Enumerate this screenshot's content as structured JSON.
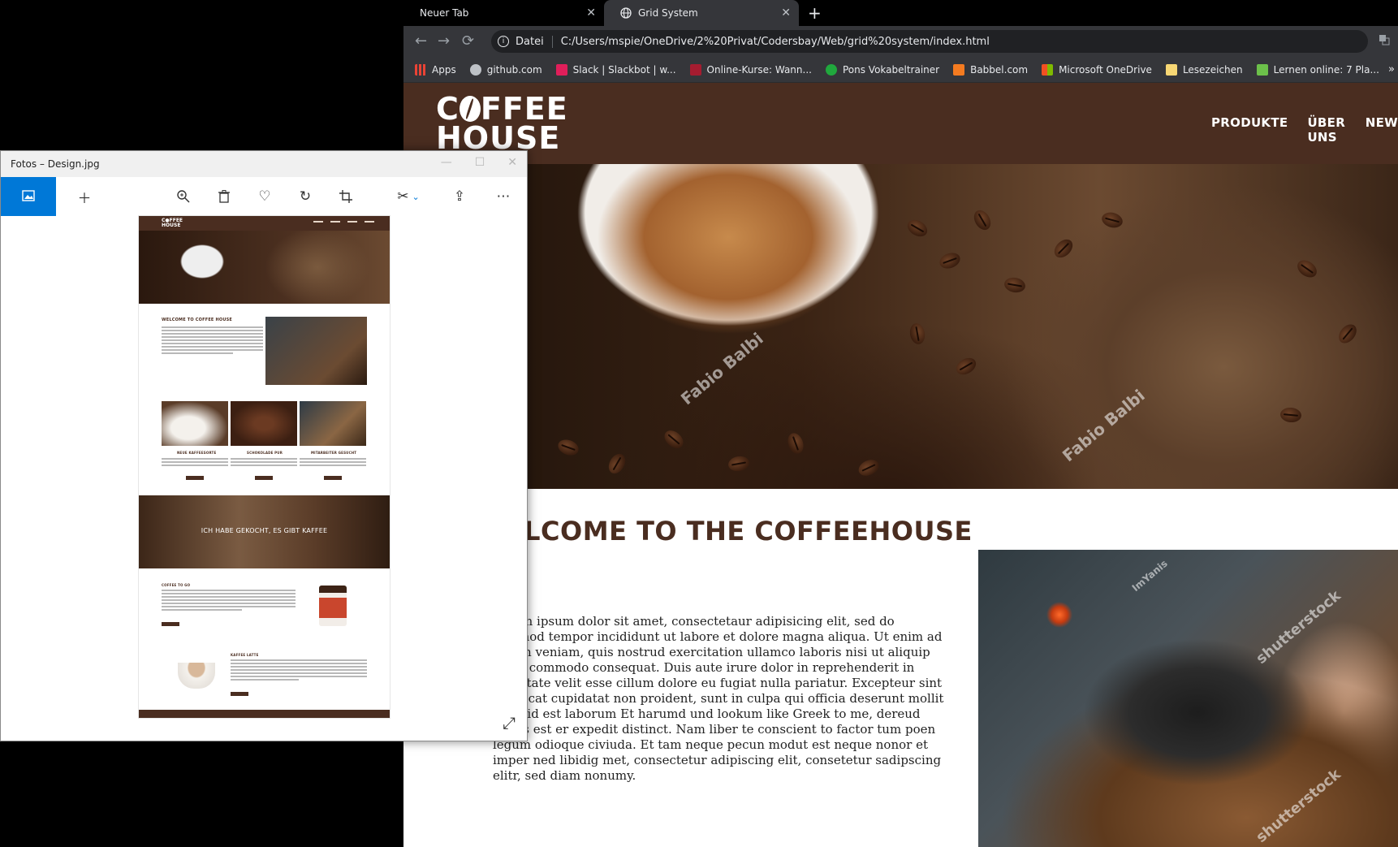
{
  "browser": {
    "tabs": [
      {
        "title": "Neuer Tab",
        "active": false
      },
      {
        "title": "Grid System",
        "active": true
      }
    ],
    "address": {
      "scheme": "Datei",
      "url": "C:/Users/mspie/OneDrive/2%20Privat/Codersbay/Web/grid%20system/index.html"
    },
    "bookmarks": [
      {
        "label": "Apps",
        "color": "#ea4335"
      },
      {
        "label": "github.com",
        "color": "#bdc1c6"
      },
      {
        "label": "Slack | Slackbot | w...",
        "color": "#e01e5a"
      },
      {
        "label": "Online-Kurse: Wann...",
        "color": "#a51c30"
      },
      {
        "label": "Pons Vokabeltrainer",
        "color": "#20a83d"
      },
      {
        "label": "Babbel.com",
        "color": "#f47b20"
      },
      {
        "label": "Microsoft OneDrive",
        "color": "#f25022"
      },
      {
        "label": "Lesezeichen",
        "color": "#f7d774"
      },
      {
        "label": "Lernen online: 7 Pla...",
        "color": "#6cc04a"
      }
    ],
    "bookmarks_more": "»"
  },
  "site": {
    "logo_line1_pre": "C",
    "logo_line1_post": "FFEE",
    "logo_line2": "HOUSE",
    "nav": [
      "PRODUKTE",
      "ÜBER UNS",
      "NEW"
    ],
    "hero_watermarks": [
      "Fabio Balbi",
      "Fabio Balbi"
    ],
    "welcome_title": "WELCOME TO THE COFFEEHOUSE",
    "welcome_text": "Lorem ipsum dolor sit amet, consectetaur adipisicing elit, sed do eiusmod tempor incididunt ut labore et dolore magna aliqua. Ut enim ad minim veniam, quis nostrud exercitation ullamco laboris nisi ut aliquip ex ea commodo consequat. Duis aute irure dolor in reprehenderit in voluptate velit esse cillum dolore eu fugiat nulla pariatur. Excepteur sint occaecat cupidatat non proident, sunt in culpa qui officia deserunt mollit anim id est laborum Et harumd und lookum like Greek to me, dereud facilis est er expedit distinct. Nam liber te conscient to factor tum poen legum odioque civiuda. Et tam neque pecun modut est neque nonor et imper ned libidig met, consectetur adipiscing elit, consetetur sadipscing elitr, sed diam nonumy.",
    "image_watermarks": [
      "ImYanis",
      "shutterstock",
      "shutterstock"
    ]
  },
  "photos": {
    "title": "Fotos – Design.jpg",
    "mock": {
      "welcome": "WELCOME TO COFFEE HOUSE",
      "cards": [
        "NEUE KAFFEESORTE",
        "SCHOKOLADE PUR",
        "MITARBEITER GESUCHT"
      ],
      "banner": "ICH HABE GEKOCHT, ES GIBT KAFFEE",
      "coffee_to_go": "COFFEE TO GO",
      "latte": "KAFFEE LATTE"
    }
  },
  "colors": {
    "brand_brown": "#4a2d20",
    "accent_blue": "#0078d7"
  }
}
